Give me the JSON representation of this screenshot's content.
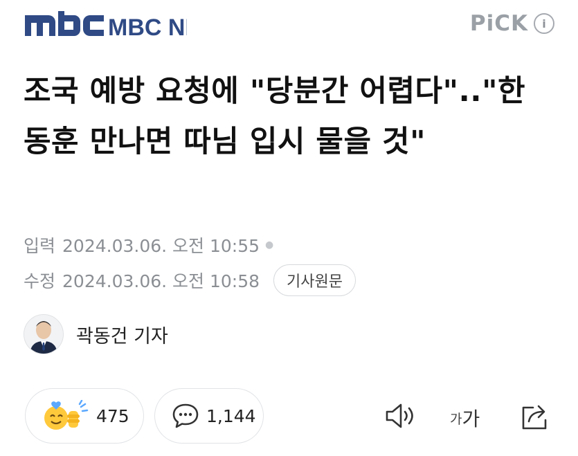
{
  "header": {
    "brand": "MBC NEWS",
    "pick_label": "PiCK",
    "info_icon": "info-icon"
  },
  "article": {
    "headline": "조국 예방 요청에 \"당분간 어렵다\"..\"한동훈 만나면 따님 입시 물을 것\"",
    "input_label": "입력",
    "input_datetime": "2024.03.06. 오전 10:55",
    "modified_label": "수정",
    "modified_datetime": "2024.03.06. 오전 10:58",
    "original_button": "기사원문",
    "reporter": "곽동건 기자"
  },
  "actions": {
    "like_count": "475",
    "comment_count": "1,144",
    "font_small": "가",
    "font_big": "가"
  },
  "colors": {
    "brand": "#2f4a85",
    "muted": "#8b8f94",
    "reaction_face": "#ffc93c",
    "reaction_heart": "#5aa8ff"
  }
}
